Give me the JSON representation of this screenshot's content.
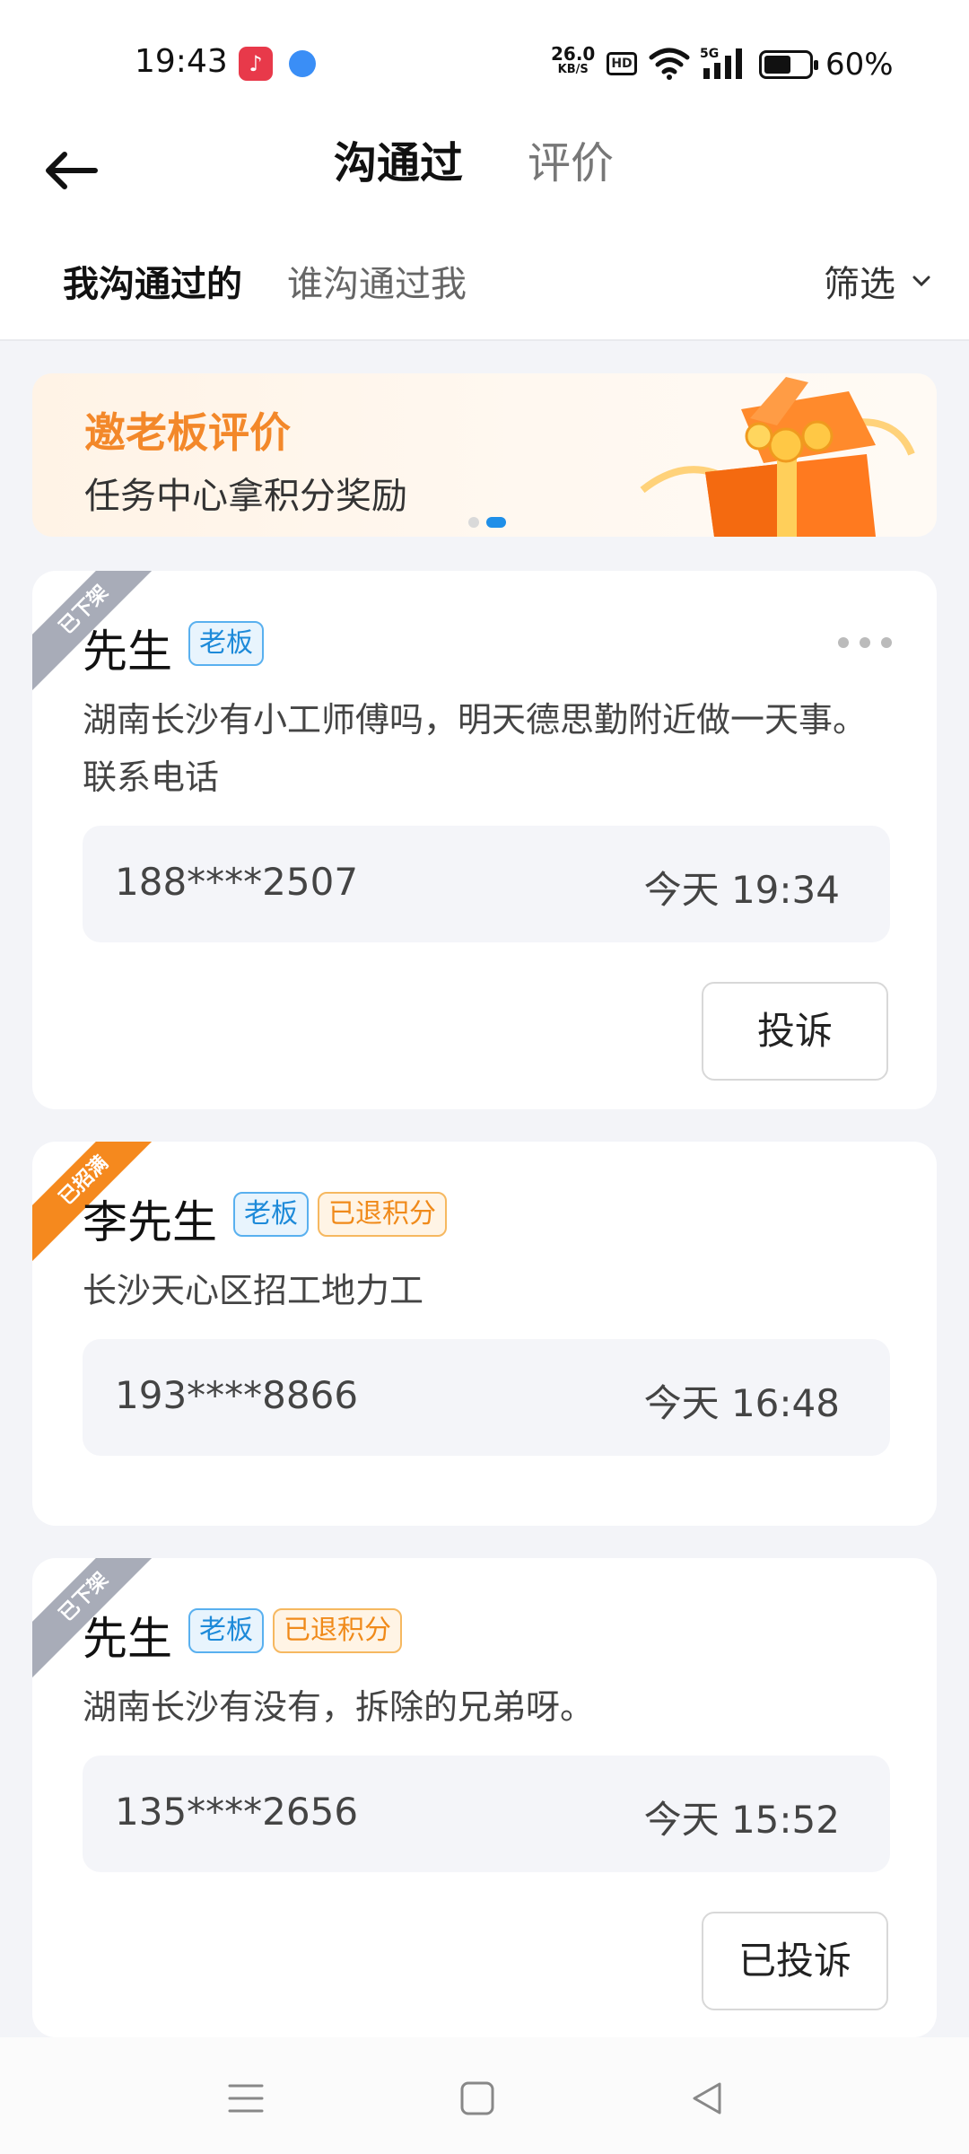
{
  "status_bar": {
    "time": "19:43",
    "net_speed_value": "26.0",
    "net_speed_unit": "KB/S",
    "hd": "HD",
    "network": "5G",
    "battery_level": 0.6,
    "battery_percent": "60%"
  },
  "header": {
    "tabs": [
      {
        "label": "沟通过",
        "active": true
      },
      {
        "label": "评价",
        "active": false
      }
    ]
  },
  "subtabs": {
    "items": [
      {
        "label": "我沟通过的",
        "active": true
      },
      {
        "label": "谁沟通过我",
        "active": false
      }
    ],
    "filter_label": "筛选"
  },
  "banner": {
    "title": "邀老板评价",
    "subtitle": "任务中心拿积分奖励",
    "page_count": 2,
    "active_page": 2
  },
  "cards": [
    {
      "ribbon": "已下架",
      "name": "先生",
      "tags": [
        "老板"
      ],
      "description": "湖南长沙有小工师傅吗，明天德思勤附近做一天事。联系电话",
      "phone": "188****2507",
      "time": "今天 19:34",
      "button": "投诉"
    },
    {
      "ribbon": "已招满",
      "name": "李先生",
      "tags": [
        "老板",
        "已退积分"
      ],
      "description": "长沙天心区招工地力工",
      "phone": "193****8866",
      "time": "今天 16:48"
    },
    {
      "ribbon": "已下架",
      "name": "先生",
      "tags": [
        "老板",
        "已退积分"
      ],
      "description": "湖南长沙有没有，拆除的兄弟呀。",
      "phone": "135****2656",
      "time": "今天 15:52",
      "button": "已投诉"
    }
  ],
  "colors": {
    "accent_blue": "#1d8ad9",
    "accent_orange": "#f3882a",
    "background": "#f3f4f8"
  }
}
